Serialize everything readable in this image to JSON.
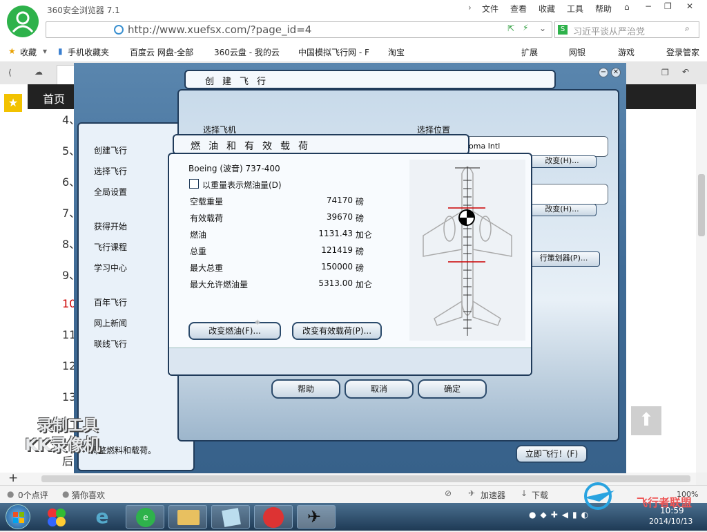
{
  "browser": {
    "title": "360安全浏览器 7.1",
    "menu": [
      "文件",
      "查看",
      "收藏",
      "工具",
      "帮助"
    ],
    "url": "http://www.xuefsx.com/?page_id=4",
    "search_placeholder": "习近平谈从严治党",
    "favorites": [
      "收藏",
      "手机收藏夹",
      "百度云 网盘-全部",
      "360云盘 - 我的云",
      "中国模拟飞行网 - F",
      "淘宝"
    ],
    "fav_right": [
      "扩展",
      "网银",
      "游戏",
      "登录管家"
    ]
  },
  "page": {
    "nav_home": "首页",
    "line_numbers": [
      "4、",
      "5、",
      "6、",
      "7、",
      "8、",
      "9、",
      "10",
      "11",
      "12",
      "13"
    ],
    "bottom_char": "后",
    "caption": "调整燃料和载荷。"
  },
  "fsx": {
    "sidebar": [
      "创建飞行",
      "选择飞行",
      "全局设置",
      "获得开始",
      "飞行课程",
      "学习中心",
      "百年飞行",
      "网上新闻",
      "联线飞行"
    ],
    "create_header": "创建飞行",
    "select_aircraft": "选择飞机",
    "select_location": "选择位置",
    "location_value": "oma Intl",
    "change_btn": "改变(H)...",
    "planner_btn": "行策划器(P)...",
    "fly_now_btn": "立即飞行！(F)",
    "fuel_header": "燃油和有效载荷",
    "aircraft": "Boeing (波音) 737-400",
    "weight_checkbox": "以重量表示燃油量(D)",
    "rows": [
      {
        "label": "空载重量",
        "value": "74170",
        "unit": "磅"
      },
      {
        "label": "有效载荷",
        "value": "39670",
        "unit": "磅"
      },
      {
        "label": "燃油",
        "value": "1131.43",
        "unit": "加仑"
      },
      {
        "label": "总重",
        "value": "121419",
        "unit": "磅"
      },
      {
        "label": "最大总重",
        "value": "150000",
        "unit": "磅"
      },
      {
        "label": "最大允许燃油量",
        "value": "5313.00",
        "unit": "加仑"
      }
    ],
    "change_fuel_btn": "改变燃油(F)...",
    "change_payload_btn": "改变有效载荷(P)...",
    "help_btn": "帮助",
    "cancel_btn": "取消",
    "ok_btn": "确定"
  },
  "watermark": {
    "line1": "录制工具",
    "line2": "KK录像机"
  },
  "status": {
    "comments": "0个点评",
    "like": "猜你喜欢",
    "accelerator": "加速器",
    "download": "下载",
    "zoom": "100%"
  },
  "taskbar": {
    "time": "10:59",
    "date": "2014/10/13"
  },
  "logo_text": "飞行者联盟"
}
